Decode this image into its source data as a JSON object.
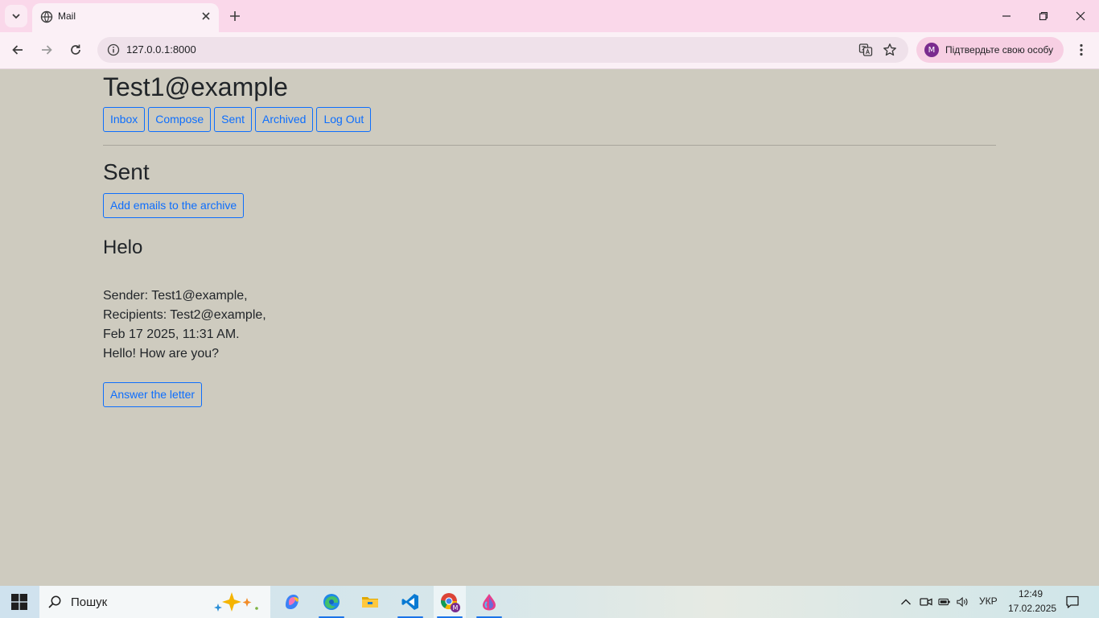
{
  "browser": {
    "tab_title": "Mail",
    "url": "127.0.0.1:8000",
    "profile_text": "Підтвердьте свою особу",
    "profile_initial": "M"
  },
  "page": {
    "user_title": "Test1@example",
    "nav": {
      "inbox": "Inbox",
      "compose": "Compose",
      "sent": "Sent",
      "archived": "Archived",
      "logout": "Log Out"
    },
    "section_title": "Sent",
    "archive_button": "Add emails to the archive",
    "email": {
      "subject": "Helo",
      "sender": "Sender: Test1@example,",
      "recipients": "Recipients: Test2@example,",
      "timestamp": "Feb 17 2025, 11:31 AM.",
      "body": "Hello! How are you?",
      "answer_button": "Answer the letter"
    }
  },
  "taskbar": {
    "search_placeholder": "Пошук",
    "language": "УКР",
    "time": "12:49",
    "date": "17.02.2025"
  },
  "colors": {
    "page_background": "#cecbbf",
    "accent": "#0d6efd",
    "tabbar": "#fad8ea"
  }
}
